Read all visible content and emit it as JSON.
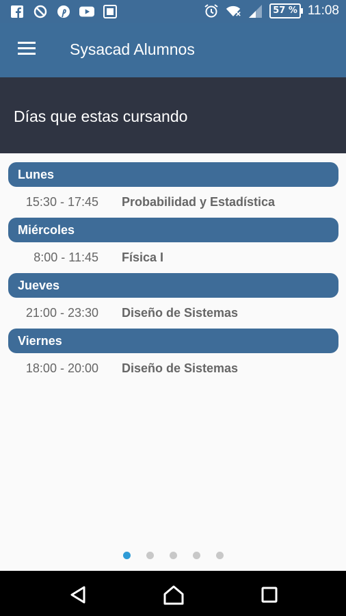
{
  "status_bar": {
    "left_icons": [
      "facebook-icon",
      "no-location-icon",
      "pinterest-icon",
      "youtube-icon",
      "gallery-icon"
    ],
    "right_icons": [
      "alarm-icon",
      "wifi-icon",
      "signal-icon"
    ],
    "battery": "57 %",
    "time": "11:08"
  },
  "appbar": {
    "title": "Sysacad Alumnos"
  },
  "header": {
    "title": "Días que estas cursando"
  },
  "schedule": [
    {
      "day": "Lunes",
      "time": "15:30 - 17:45",
      "subject": "Probabilidad y Estadística"
    },
    {
      "day": "Miércoles",
      "time": "8:00 - 11:45",
      "subject": "Física I"
    },
    {
      "day": "Jueves",
      "time": "21:00 - 23:30",
      "subject": "Diseño de Sistemas"
    },
    {
      "day": "Viernes",
      "time": "18:00 - 20:00",
      "subject": "Diseño de Sistemas"
    }
  ],
  "pager": {
    "count": 5,
    "active": 0
  },
  "colors": {
    "primary": "#3e6c98",
    "header_dark": "#2f3442",
    "dot_active": "#2f9bd6",
    "dot_inactive": "#c8c8c8"
  }
}
